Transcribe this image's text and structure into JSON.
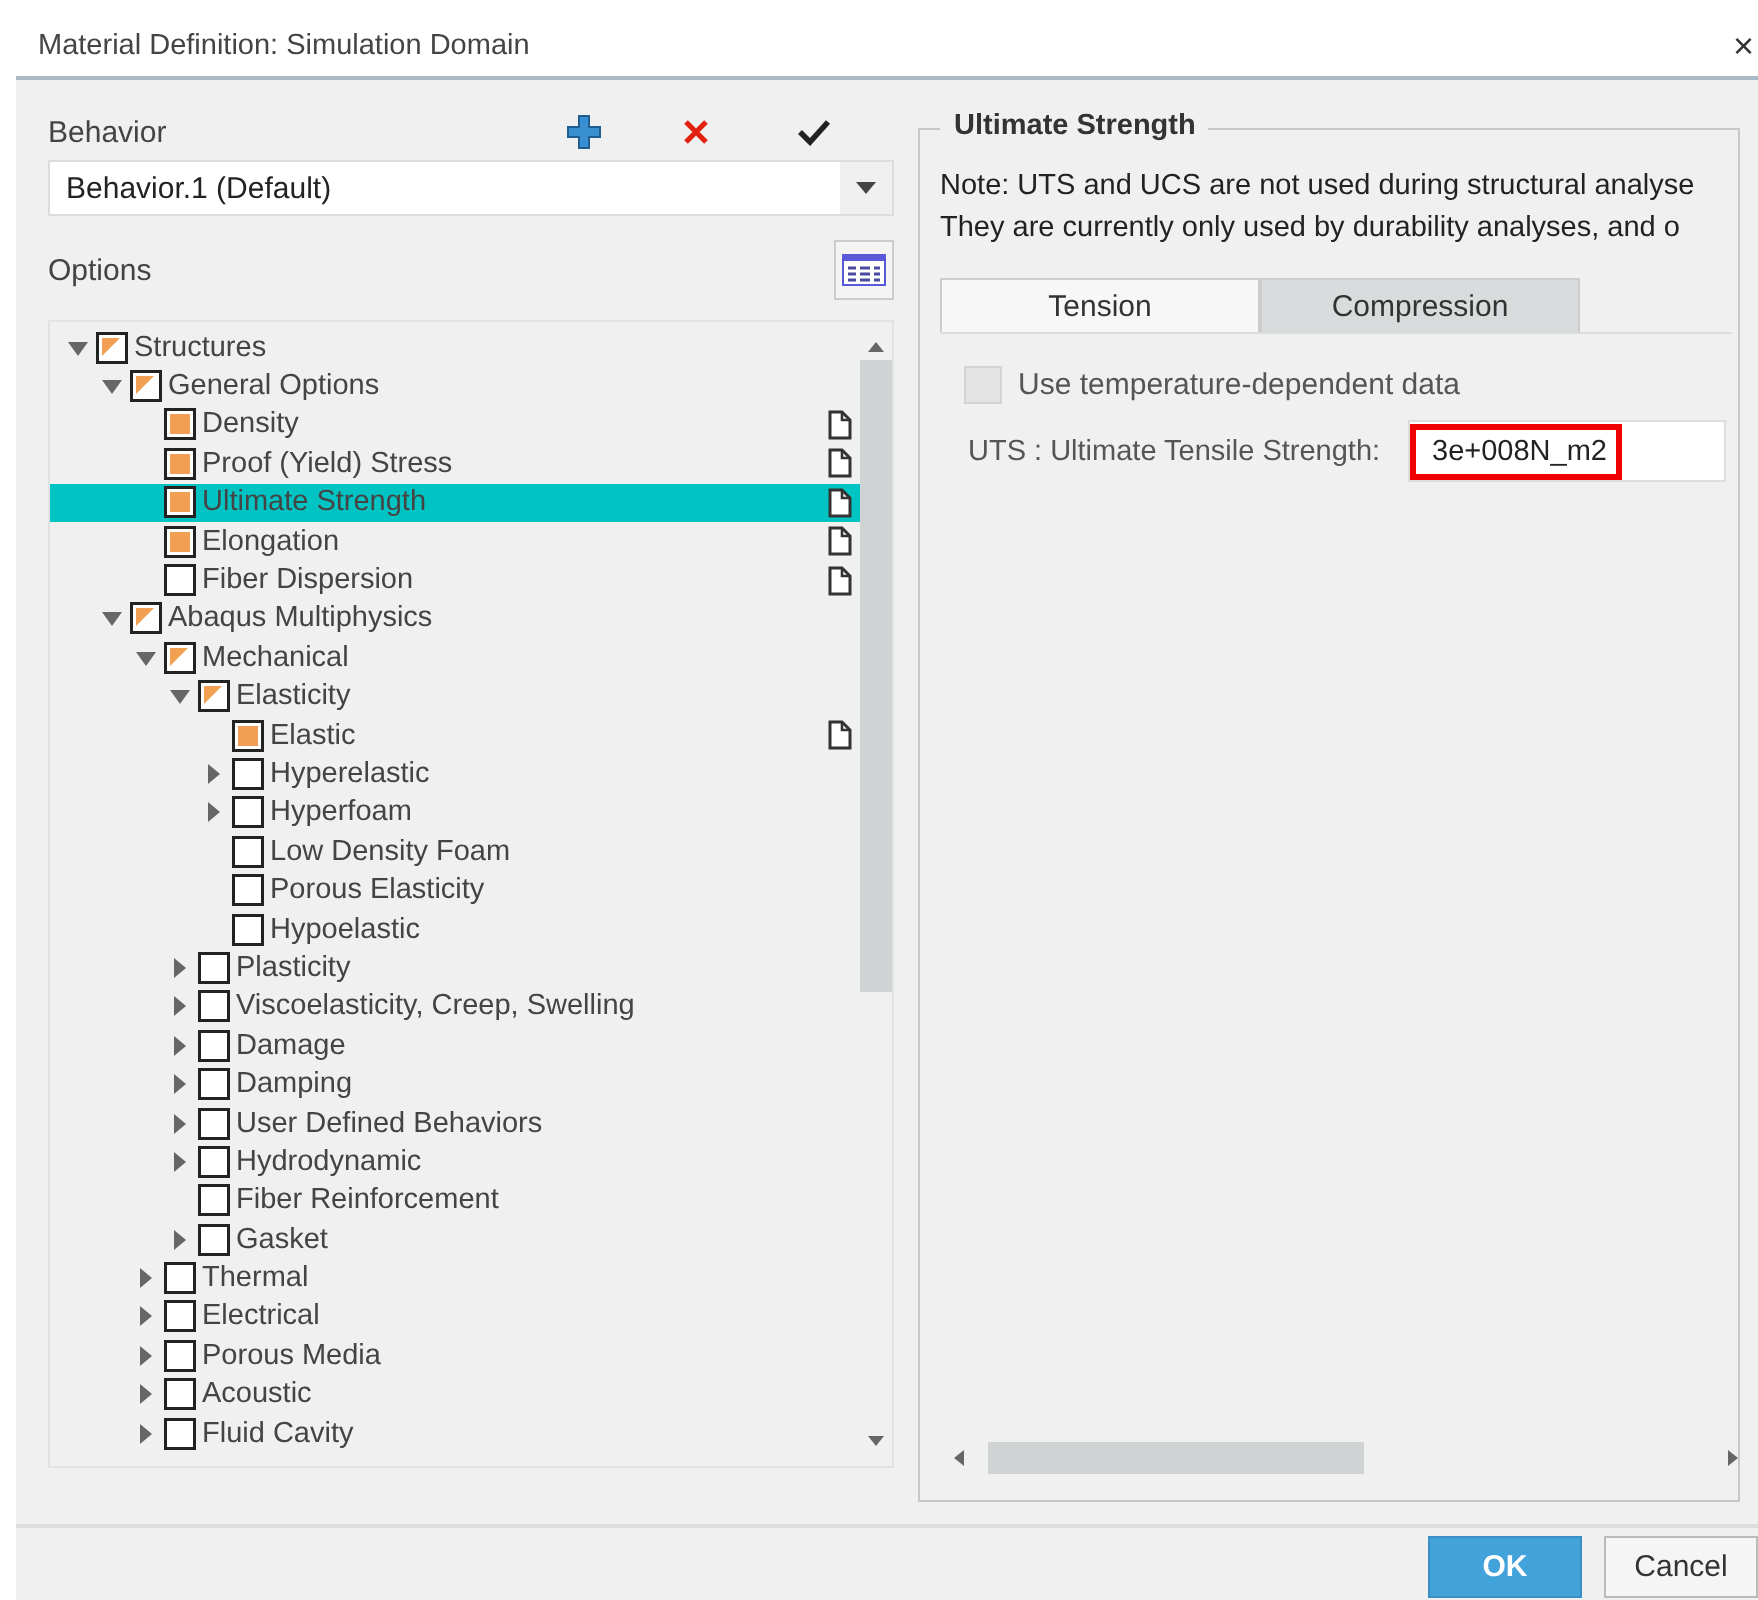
{
  "window": {
    "title": "Material Definition: Simulation Domain",
    "close": "×"
  },
  "behavior": {
    "label": "Behavior",
    "value": "Behavior.1 (Default)"
  },
  "options": {
    "label": "Options"
  },
  "tree": [
    {
      "label": "Structures",
      "checked": false,
      "partial": true,
      "expanded": true,
      "selected": false,
      "children": [
        {
          "label": "General Options",
          "checked": false,
          "partial": true,
          "expanded": true,
          "selected": false,
          "children": [
            {
              "label": "Density",
              "checked": true,
              "partial": false,
              "has_data": true,
              "selected": false
            },
            {
              "label": "Proof (Yield) Stress",
              "checked": true,
              "partial": false,
              "has_data": true,
              "selected": false
            },
            {
              "label": "Ultimate Strength",
              "checked": true,
              "partial": false,
              "has_data": true,
              "selected": true
            },
            {
              "label": "Elongation",
              "checked": true,
              "partial": false,
              "has_data": true,
              "selected": false
            },
            {
              "label": "Fiber Dispersion",
              "checked": false,
              "partial": false,
              "has_data": true,
              "selected": false
            }
          ]
        },
        {
          "label": "Abaqus Multiphysics",
          "checked": false,
          "partial": true,
          "expanded": true,
          "selected": false,
          "children": [
            {
              "label": "Mechanical",
              "checked": false,
              "partial": true,
              "expanded": true,
              "selected": false,
              "children": [
                {
                  "label": "Elasticity",
                  "checked": false,
                  "partial": true,
                  "expanded": true,
                  "selected": false,
                  "children": [
                    {
                      "label": "Elastic",
                      "checked": true,
                      "partial": false,
                      "has_data": true,
                      "selected": false
                    },
                    {
                      "label": "Hyperelastic",
                      "checked": false,
                      "partial": false,
                      "expanded": false,
                      "selected": false
                    },
                    {
                      "label": "Hyperfoam",
                      "checked": false,
                      "partial": false,
                      "expanded": false,
                      "selected": false
                    },
                    {
                      "label": "Low Density Foam",
                      "checked": false,
                      "partial": false,
                      "selected": false
                    },
                    {
                      "label": "Porous Elasticity",
                      "checked": false,
                      "partial": false,
                      "selected": false
                    },
                    {
                      "label": "Hypoelastic",
                      "checked": false,
                      "partial": false,
                      "selected": false
                    }
                  ]
                },
                {
                  "label": "Plasticity",
                  "checked": false,
                  "partial": false,
                  "expanded": false,
                  "selected": false
                },
                {
                  "label": "Viscoelasticity, Creep, Swelling",
                  "checked": false,
                  "partial": false,
                  "expanded": false,
                  "selected": false
                },
                {
                  "label": "Damage",
                  "checked": false,
                  "partial": false,
                  "expanded": false,
                  "selected": false
                },
                {
                  "label": "Damping",
                  "checked": false,
                  "partial": false,
                  "expanded": false,
                  "selected": false
                },
                {
                  "label": "User Defined Behaviors",
                  "checked": false,
                  "partial": false,
                  "expanded": false,
                  "selected": false
                },
                {
                  "label": "Hydrodynamic",
                  "checked": false,
                  "partial": false,
                  "expanded": false,
                  "selected": false
                },
                {
                  "label": "Fiber Reinforcement",
                  "checked": false,
                  "partial": false,
                  "selected": false
                },
                {
                  "label": "Gasket",
                  "checked": false,
                  "partial": false,
                  "expanded": false,
                  "selected": false
                }
              ]
            },
            {
              "label": "Thermal",
              "checked": false,
              "partial": false,
              "expanded": false,
              "selected": false
            },
            {
              "label": "Electrical",
              "checked": false,
              "partial": false,
              "expanded": false,
              "selected": false
            },
            {
              "label": "Porous Media",
              "checked": false,
              "partial": false,
              "expanded": false,
              "selected": false
            },
            {
              "label": "Acoustic",
              "checked": false,
              "partial": false,
              "expanded": false,
              "selected": false
            },
            {
              "label": "Fluid Cavity",
              "checked": false,
              "partial": false,
              "expanded": false,
              "selected": false
            }
          ]
        }
      ]
    }
  ],
  "group": {
    "title": "Ultimate Strength",
    "note": [
      "Note: UTS and UCS are not used during structural analyse",
      "They are currently only used by durability analyses, and o"
    ],
    "tabs": [
      {
        "label": "Tension",
        "selected": true
      },
      {
        "label": "Compression",
        "selected": false
      }
    ],
    "temperature": {
      "label": "Use temperature-dependent data",
      "checked": false,
      "disabled": true
    },
    "uts": {
      "label": "UTS : Ultimate Tensile Strength:",
      "value": "3e+008N_m2",
      "highlighted": true
    }
  },
  "buttons": [
    {
      "label": "OK",
      "kind": "primary"
    },
    {
      "label": "Cancel",
      "kind": "secondary"
    }
  ]
}
